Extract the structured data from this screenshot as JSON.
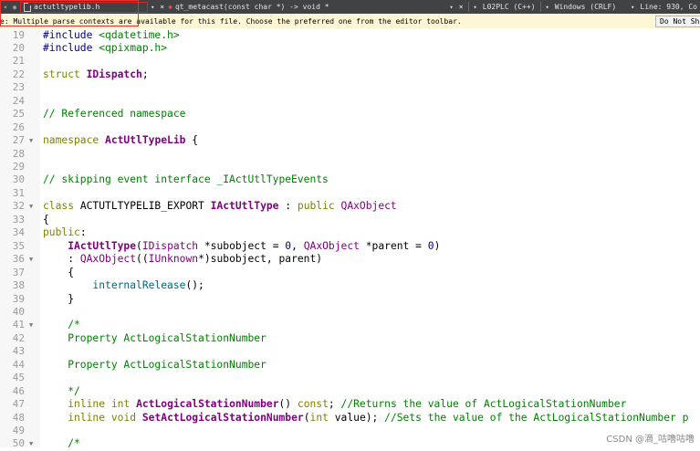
{
  "toolbar": {
    "file_name": "actutltypelib.h",
    "file_close": "×",
    "symbol": "qt_metacast(const char *) -> void *",
    "symbol_close": "×",
    "language": "L02PLC (C++)",
    "line_endings": "Windows (CRLF)",
    "position": "Line: 930, Co"
  },
  "warning": {
    "text": "e: Multiple parse contexts are available for this file. Choose the preferred one from the editor toolbar.",
    "button": "Do Not Sho"
  },
  "watermark": "CSDN @滴_咕噜咕噜",
  "lines": [
    {
      "num": "19",
      "fold": false,
      "text": "#include <qdatetime.h>"
    },
    {
      "num": "20",
      "fold": false,
      "text": "#include <qpixmap.h>"
    },
    {
      "num": "21",
      "fold": false,
      "text": ""
    },
    {
      "num": "22",
      "fold": false,
      "text": "struct IDispatch;"
    },
    {
      "num": "23",
      "fold": false,
      "text": ""
    },
    {
      "num": "24",
      "fold": false,
      "text": ""
    },
    {
      "num": "25",
      "fold": false,
      "text": "// Referenced namespace"
    },
    {
      "num": "26",
      "fold": false,
      "text": ""
    },
    {
      "num": "27",
      "fold": true,
      "text": "namespace ActUtlTypeLib {"
    },
    {
      "num": "28",
      "fold": false,
      "text": ""
    },
    {
      "num": "29",
      "fold": false,
      "text": ""
    },
    {
      "num": "30",
      "fold": false,
      "text": "// skipping event interface _IActUtlTypeEvents"
    },
    {
      "num": "31",
      "fold": false,
      "text": ""
    },
    {
      "num": "32",
      "fold": true,
      "text": "class ACTUTLTYPELIB_EXPORT IActUtlType : public QAxObject"
    },
    {
      "num": "33",
      "fold": false,
      "text": "{"
    },
    {
      "num": "34",
      "fold": false,
      "text": "public:"
    },
    {
      "num": "35",
      "fold": false,
      "text": "    IActUtlType(IDispatch *subobject = 0, QAxObject *parent = 0)"
    },
    {
      "num": "36",
      "fold": true,
      "text": "    : QAxObject((IUnknown*)subobject, parent)"
    },
    {
      "num": "37",
      "fold": false,
      "text": "    {"
    },
    {
      "num": "38",
      "fold": false,
      "text": "        internalRelease();"
    },
    {
      "num": "39",
      "fold": false,
      "text": "    }"
    },
    {
      "num": "40",
      "fold": false,
      "text": ""
    },
    {
      "num": "41",
      "fold": true,
      "text": "    /*"
    },
    {
      "num": "42",
      "fold": false,
      "text": "    Property ActLogicalStationNumber"
    },
    {
      "num": "43",
      "fold": false,
      "text": ""
    },
    {
      "num": "44",
      "fold": false,
      "text": "    Property ActLogicalStationNumber"
    },
    {
      "num": "45",
      "fold": false,
      "text": ""
    },
    {
      "num": "46",
      "fold": false,
      "text": "    */"
    },
    {
      "num": "47",
      "fold": false,
      "text": "    inline int ActLogicalStationNumber() const; //Returns the value of ActLogicalStationNumber"
    },
    {
      "num": "48",
      "fold": false,
      "text": "    inline void SetActLogicalStationNumber(int value); //Sets the value of the ActLogicalStationNumber p"
    },
    {
      "num": "49",
      "fold": false,
      "text": ""
    },
    {
      "num": "50",
      "fold": true,
      "text": "    /*"
    }
  ]
}
